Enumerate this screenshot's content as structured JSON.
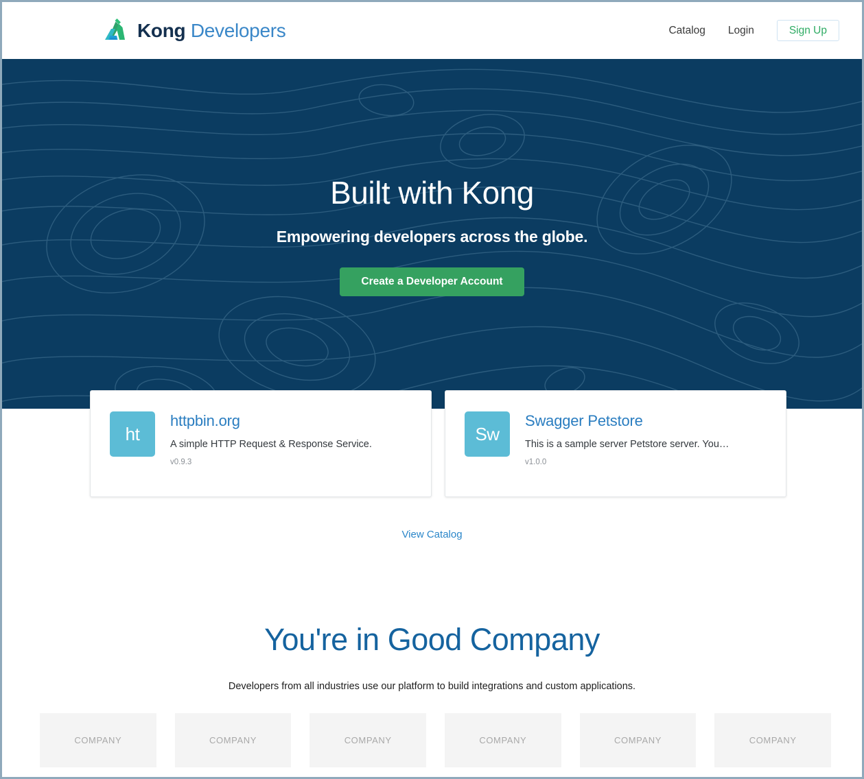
{
  "header": {
    "brand": {
      "logo_icon": "kong-gavel-icon",
      "name_primary": "Kong",
      "name_secondary": "Developers",
      "color_primary": "#14304f",
      "color_secondary": "#3a87c8"
    },
    "nav": [
      {
        "label": "Catalog",
        "name": "nav-link-catalog"
      },
      {
        "label": "Login",
        "name": "nav-link-login"
      }
    ],
    "signup_label": "Sign Up",
    "signup_color": "#2eab63"
  },
  "hero": {
    "title": "Built with Kong",
    "subtitle": "Empowering developers across the globe.",
    "cta_label": "Create a Developer Account",
    "background_color": "#0b3c61",
    "cta_color": "#35a160",
    "background_pattern": "topographic-contour-lines"
  },
  "catalog": {
    "cards": [
      {
        "icon_text": "ht",
        "title": "httpbin.org",
        "description": "A simple HTTP Request & Response Service.",
        "version": "v0.9.3",
        "icon_color": "#5cbcd6"
      },
      {
        "icon_text": "Sw",
        "title": "Swagger Petstore",
        "description": "This is a sample server Petstore server. You…",
        "version": "v1.0.0",
        "icon_color": "#5cbcd6"
      }
    ],
    "view_catalog_label": "View Catalog",
    "view_catalog_color": "#2a86c9"
  },
  "good_company": {
    "title": "You're in Good Company",
    "title_color": "#15639f",
    "subtitle": "Developers from all industries use our platform to build integrations and custom applications.",
    "logos": [
      {
        "label": "COMPANY"
      },
      {
        "label": "COMPANY"
      },
      {
        "label": "COMPANY"
      },
      {
        "label": "COMPANY"
      },
      {
        "label": "COMPANY"
      },
      {
        "label": "COMPANY"
      }
    ]
  }
}
